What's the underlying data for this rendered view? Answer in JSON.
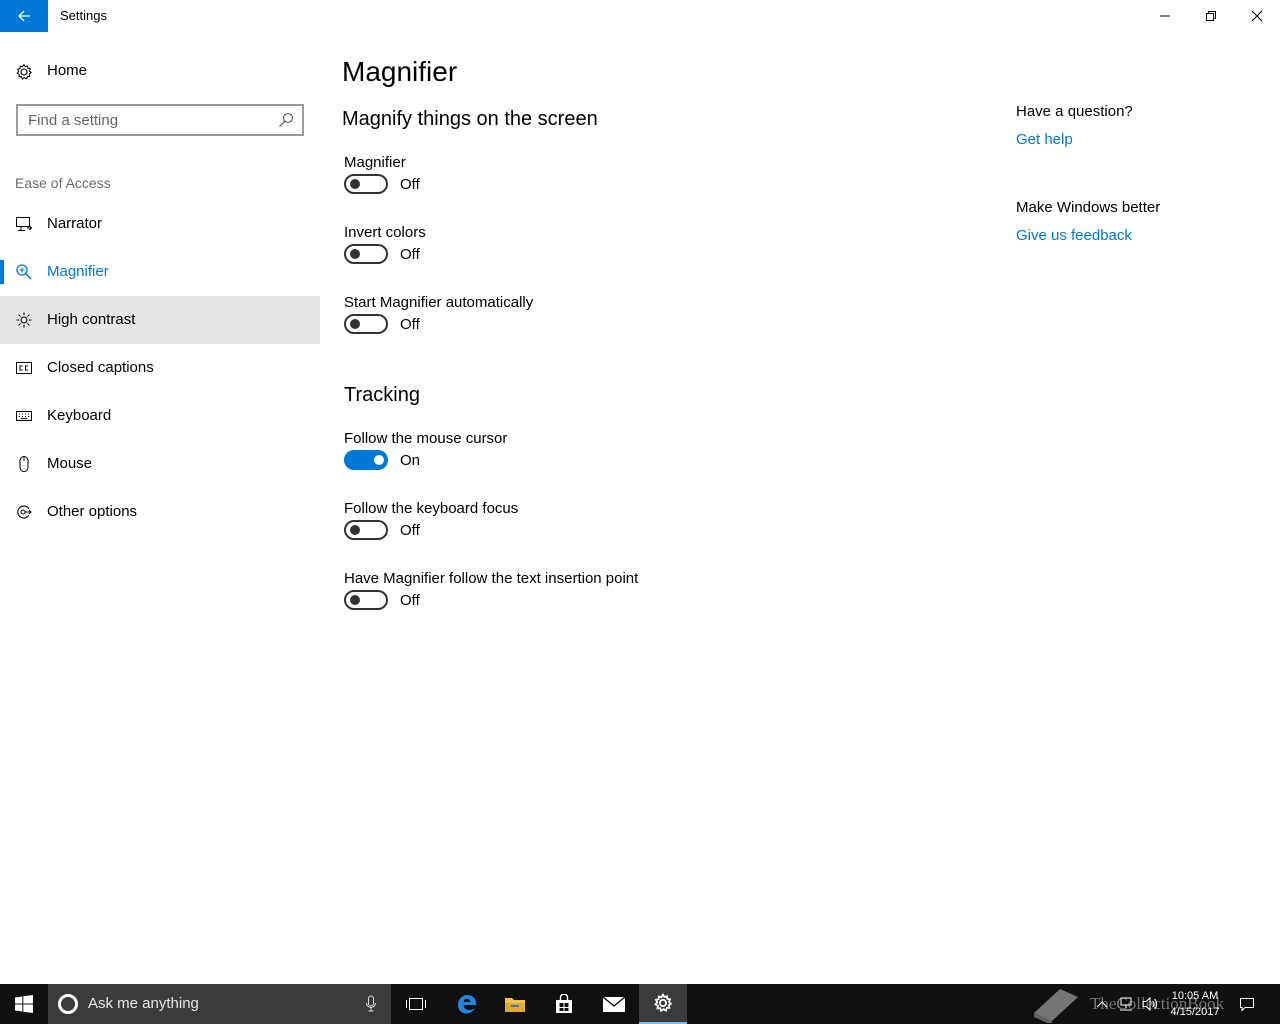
{
  "window": {
    "title": "Settings"
  },
  "sidebar": {
    "home_label": "Home",
    "search_placeholder": "Find a setting",
    "section_label": "Ease of Access",
    "items": [
      {
        "label": "Narrator",
        "icon": "narrator-icon"
      },
      {
        "label": "Magnifier",
        "icon": "magnifier-icon",
        "active": true
      },
      {
        "label": "High contrast",
        "icon": "brightness-icon",
        "hover": true
      },
      {
        "label": "Closed captions",
        "icon": "closed-captions-icon"
      },
      {
        "label": "Keyboard",
        "icon": "keyboard-icon"
      },
      {
        "label": "Mouse",
        "icon": "mouse-icon"
      },
      {
        "label": "Other options",
        "icon": "other-options-icon"
      }
    ]
  },
  "main": {
    "page_title": "Magnifier",
    "group1_title": "Magnify things on the screen",
    "group2_title": "Tracking",
    "settings": [
      {
        "name": "Magnifier",
        "state": "Off",
        "on": false
      },
      {
        "name": "Invert colors",
        "state": "Off",
        "on": false
      },
      {
        "name": "Start Magnifier automatically",
        "state": "Off",
        "on": false
      },
      {
        "name": "Follow the mouse cursor",
        "state": "On",
        "on": true
      },
      {
        "name": "Follow the keyboard focus",
        "state": "Off",
        "on": false
      },
      {
        "name": "Have Magnifier follow the text insertion point",
        "state": "Off",
        "on": false
      }
    ]
  },
  "help": {
    "question": "Have a question?",
    "get_help": "Get help",
    "make_better": "Make Windows better",
    "feedback": "Give us feedback"
  },
  "taskbar": {
    "search_placeholder": "Ask me anything",
    "time": "10:05 AM",
    "date": "4/15/2017",
    "watermark": "TheCollectionBook"
  },
  "colors": {
    "accent": "#0078d7",
    "hover": "#e6e6e6",
    "taskbar": "#101010"
  }
}
